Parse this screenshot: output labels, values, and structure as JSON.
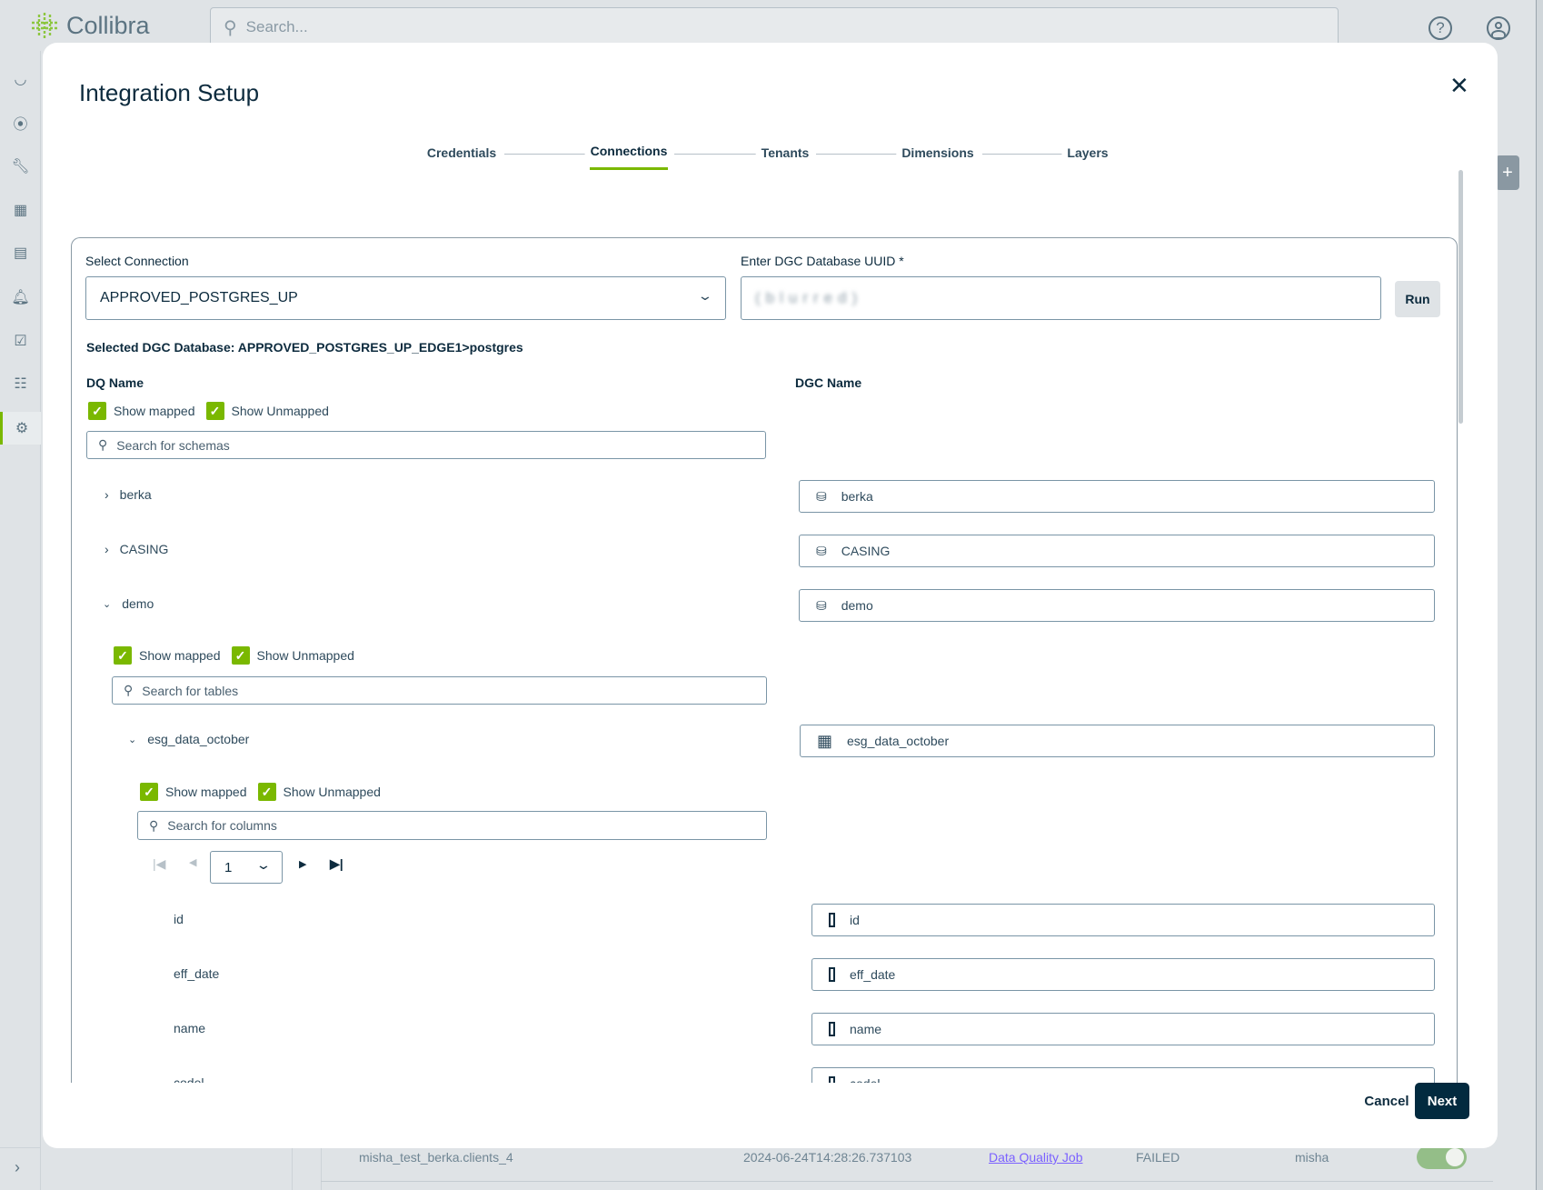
{
  "app": {
    "brand": "Collibra",
    "search_placeholder": "Search...",
    "help_icon": "help-icon",
    "user_icon": "user-icon"
  },
  "sidebar": {
    "items": [
      {
        "icon": "dashboard-icon"
      },
      {
        "icon": "compass-icon"
      },
      {
        "icon": "wrench-icon"
      },
      {
        "icon": "table-icon"
      },
      {
        "icon": "report-icon"
      },
      {
        "icon": "bell-icon"
      },
      {
        "icon": "clipboard-check-icon"
      },
      {
        "icon": "calendar-icon"
      },
      {
        "icon": "gear-icon",
        "active": true
      }
    ]
  },
  "modal": {
    "title": "Integration Setup",
    "steps": [
      {
        "label": "Credentials"
      },
      {
        "label": "Connections",
        "active": true
      },
      {
        "label": "Tenants"
      },
      {
        "label": "Dimensions"
      },
      {
        "label": "Layers"
      }
    ],
    "select_connection_label": "Select Connection",
    "select_connection_value": "APPROVED_POSTGRES_UP",
    "uuid_label": "Enter DGC Database UUID *",
    "uuid_value": "(blurred)",
    "run_label": "Run",
    "selected_db": "Selected DGC Database: APPROVED_POSTGRES_UP_EDGE1>postgres",
    "dq_name_header": "DQ Name",
    "dgc_name_header": "DGC Name",
    "show_mapped": "Show mapped",
    "show_unmapped": "Show Unmapped",
    "schema_search_placeholder": "Search for schemas",
    "table_search_placeholder": "Search for tables",
    "column_search_placeholder": "Search for columns",
    "schemas": [
      {
        "name": "berka",
        "dgc": "berka",
        "expanded": false
      },
      {
        "name": "CASING",
        "dgc": "CASING",
        "expanded": false
      },
      {
        "name": "demo",
        "dgc": "demo",
        "expanded": true
      }
    ],
    "table": {
      "name": "esg_data_october",
      "dgc": "esg_data_october"
    },
    "page": "1",
    "columns": [
      {
        "name": "id",
        "dgc": "id"
      },
      {
        "name": "eff_date",
        "dgc": "eff_date"
      },
      {
        "name": "name",
        "dgc": "name"
      },
      {
        "name": "codel",
        "dgc": "codel"
      }
    ],
    "cancel_label": "Cancel",
    "next_label": "Next"
  },
  "background_row": {
    "name": "misha_test_berka.clients_4",
    "timestamp": "2024-06-24T14:28:26.737103",
    "link": "Data Quality Job",
    "status": "FAILED",
    "user": "misha",
    "toggle_on": true
  },
  "colors": {
    "accent": "#7ab800",
    "primary": "#022a3f",
    "link": "#7b61ff"
  }
}
